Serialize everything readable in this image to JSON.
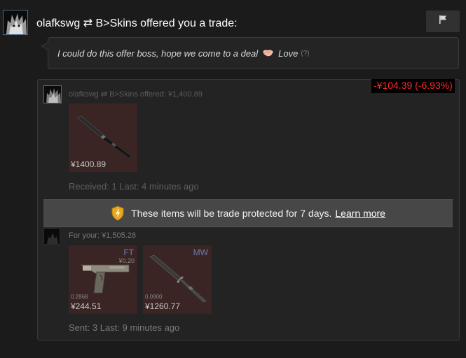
{
  "header": {
    "title": "olafkswg ⇄ B>Skins offered you a trade:"
  },
  "message": {
    "text": "I could do this offer boss, hope we come to a deal",
    "suffix": "Love",
    "help": "(?)"
  },
  "trade": {
    "price_diff": "-¥104.39 (-6.93%)",
    "price_diff_color": "#ff2a2a",
    "offer_label": "olafkswg ⇄ B>Skins offered: ¥1,400.89",
    "offered_items": [
      {
        "price": "¥1400.89",
        "icon": "knife-icon"
      }
    ],
    "received_status": "Received: 1 Last: 4 minutes ago",
    "protect_banner": {
      "text": "These items will be trade protected for 7 days.",
      "link": "Learn more",
      "icon": "shield-lightning-icon"
    },
    "for_label": "For your: ¥1,505.28",
    "your_items": [
      {
        "wear": "FT",
        "sticker_price": "¥0.20",
        "float": "0.2868",
        "price": "¥244.51",
        "icon": "pistol-icon"
      },
      {
        "wear": "MW",
        "float": "0.0900",
        "price": "¥1260.77",
        "icon": "bayonet-icon"
      }
    ],
    "sent_status": "Sent: 3 Last: 9 minutes ago"
  },
  "colors": {
    "background": "#1b1b1c",
    "item_card": "#3a2424",
    "wear_text": "#6a7fae",
    "banner": "#474747"
  }
}
